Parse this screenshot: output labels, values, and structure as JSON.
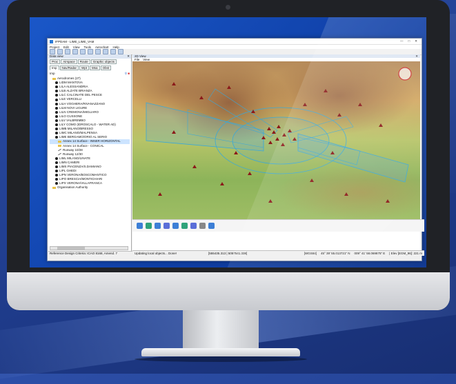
{
  "window": {
    "title": "IFPDAM - LIME_LIME_VAM",
    "menu": [
      "Project",
      "Edit",
      "View",
      "Tools",
      "Aerochart",
      "Help"
    ]
  },
  "left_panel": {
    "title": "Data view",
    "tabs_row1": [
      "Proc",
      "Airspace",
      "Route",
      "Graphic objects"
    ],
    "tabs_row2": [
      "Imp",
      "Nav/Radar",
      "Wpt",
      "Msa",
      "Obst"
    ],
    "search_label": "Imp",
    "tree": [
      {
        "label": "Aerodromes (27)",
        "type": "folder",
        "level": 0
      },
      {
        "label": "LIDM MANTOVA",
        "type": "aerodrome",
        "level": 1
      },
      {
        "label": "LILA ALESSANDRIA",
        "type": "aerodrome",
        "level": 1
      },
      {
        "label": "LILB ALZATE BRIANZA",
        "type": "aerodrome",
        "level": 1
      },
      {
        "label": "LILC CALCINATE DEL PESCE",
        "type": "aerodrome",
        "level": 1
      },
      {
        "label": "LILE VERCELLI",
        "type": "aerodrome",
        "level": 1
      },
      {
        "label": "LILH VOGHERA/RIVANAZZANO",
        "type": "aerodrome",
        "level": 1
      },
      {
        "label": "LILM NOVI LIGURE",
        "type": "aerodrome",
        "level": 1
      },
      {
        "label": "LILN CREMONA/MIGLIARO",
        "type": "aerodrome",
        "level": 1
      },
      {
        "label": "LILO CUSSONE",
        "type": "aerodrome",
        "level": 1
      },
      {
        "label": "LILV VALBREMBO",
        "type": "aerodrome",
        "level": 1
      },
      {
        "label": "LILY COMO (IDROSCALO - WATER AD)",
        "type": "aerodrome",
        "level": 1
      },
      {
        "label": "LIMB MILANO/BRESSO",
        "type": "aerodrome",
        "level": 1
      },
      {
        "label": "LIMC MILANO/MALPENSA",
        "type": "aerodrome",
        "level": 1
      },
      {
        "label": "LIME BERGAMO/ORIO AL SERIO",
        "type": "aerodrome",
        "level": 1
      },
      {
        "label": "Annex 14 Surface - INNER HORIZONTAL",
        "type": "folder",
        "level": 2,
        "selected": true
      },
      {
        "label": "Annex 14 Surface - CONICAL",
        "type": "folder",
        "level": 2
      },
      {
        "label": "Runway 10/28",
        "type": "runway",
        "level": 2
      },
      {
        "label": "Runway 12/30",
        "type": "runway",
        "level": 2
      },
      {
        "label": "LIML MILANO/LINATE",
        "type": "aerodrome",
        "level": 1
      },
      {
        "label": "LIMN CAMERI",
        "type": "aerodrome",
        "level": 1
      },
      {
        "label": "LIMS PIACENZA/S.DAMIANO",
        "type": "aerodrome",
        "level": 1
      },
      {
        "label": "LIPL GHEDI",
        "type": "aerodrome",
        "level": 1
      },
      {
        "label": "LIPN VERONA/BOSCOMANTICO",
        "type": "aerodrome",
        "level": 1
      },
      {
        "label": "LIPO BRESCIA/MONTICHIARI",
        "type": "aerodrome",
        "level": 1
      },
      {
        "label": "LIPX VERONA/VILLAFRANCA",
        "type": "aerodrome",
        "level": 1
      },
      {
        "label": "Organisation Authority",
        "type": "folder",
        "level": 0
      }
    ],
    "status": "Reference Design Criteria: ICAO 8168, Amend. 7"
  },
  "map_window": {
    "tab": "2D View",
    "menu": [
      "File",
      "View"
    ],
    "status_message": "Updating local objects... Done!",
    "extent": "[555435.313 | 5057541.338]",
    "datum": "[WGS84]",
    "lat": "45° 39' 55.013721\" N",
    "lon": "009° 41' 58.069875\" E",
    "elev": "| Elev [EGM_96]: 221 m"
  },
  "colors": {
    "screen_bg": "#1a57c8",
    "page_bg": "#1f3c8c",
    "airspace_line": "#3aa8d8",
    "obstacle": "#8b1a1a"
  }
}
